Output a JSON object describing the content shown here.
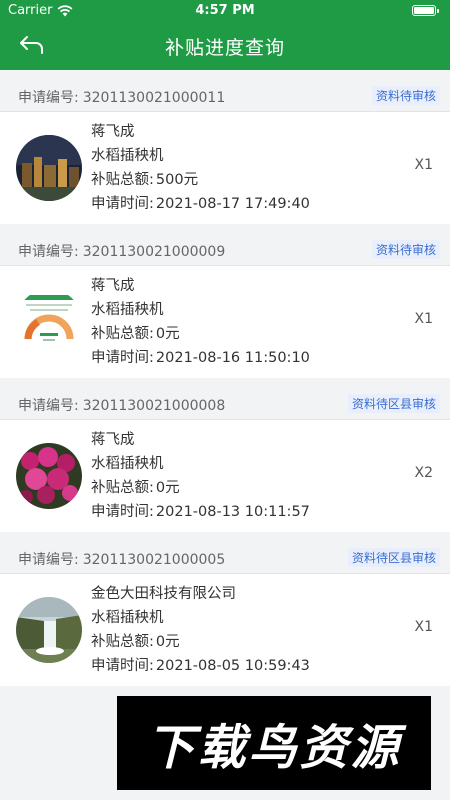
{
  "status_bar": {
    "carrier": "Carrier",
    "time": "4:57 PM",
    "wifi_icon": "wifi-icon",
    "battery_icon": "battery-icon"
  },
  "nav": {
    "title": "补贴进度查询",
    "back_icon": "back-arrow-icon"
  },
  "colors": {
    "header_green": "#1f9a45",
    "badge_blue": "#3a6fd0",
    "badge_bg": "#e8eefb"
  },
  "labels": {
    "app_no": "申请编号:",
    "subsidy": "补贴总额:",
    "apply_time": "申请时间:"
  },
  "records": [
    {
      "app_no": "3201130021000011",
      "status": "资料待审核",
      "name": "蒋飞成",
      "machine": "水稻插秧机",
      "subsidy": "500元",
      "apply_time": "2021-08-17 17:49:40",
      "qty": "X1",
      "thumb": "night-city-photo"
    },
    {
      "app_no": "3201130021000009",
      "status": "资料待审核",
      "name": "蒋飞成",
      "machine": "水稻插秧机",
      "subsidy": "0元",
      "apply_time": "2021-08-16 11:50:10",
      "qty": "X1",
      "thumb": "progress-gauge-screenshot"
    },
    {
      "app_no": "3201130021000008",
      "status": "资料待区县审核",
      "name": "蒋飞成",
      "machine": "水稻插秧机",
      "subsidy": "0元",
      "apply_time": "2021-08-13 10:11:57",
      "qty": "X2",
      "thumb": "flowers-photo"
    },
    {
      "app_no": "3201130021000005",
      "status": "资料待区县审核",
      "name": "金色大田科技有限公司",
      "machine": "水稻插秧机",
      "subsidy": "0元",
      "apply_time": "2021-08-05 10:59:43",
      "qty": "X1",
      "thumb": "waterfall-photo"
    }
  ],
  "watermark": {
    "text": "下载鸟资源"
  }
}
